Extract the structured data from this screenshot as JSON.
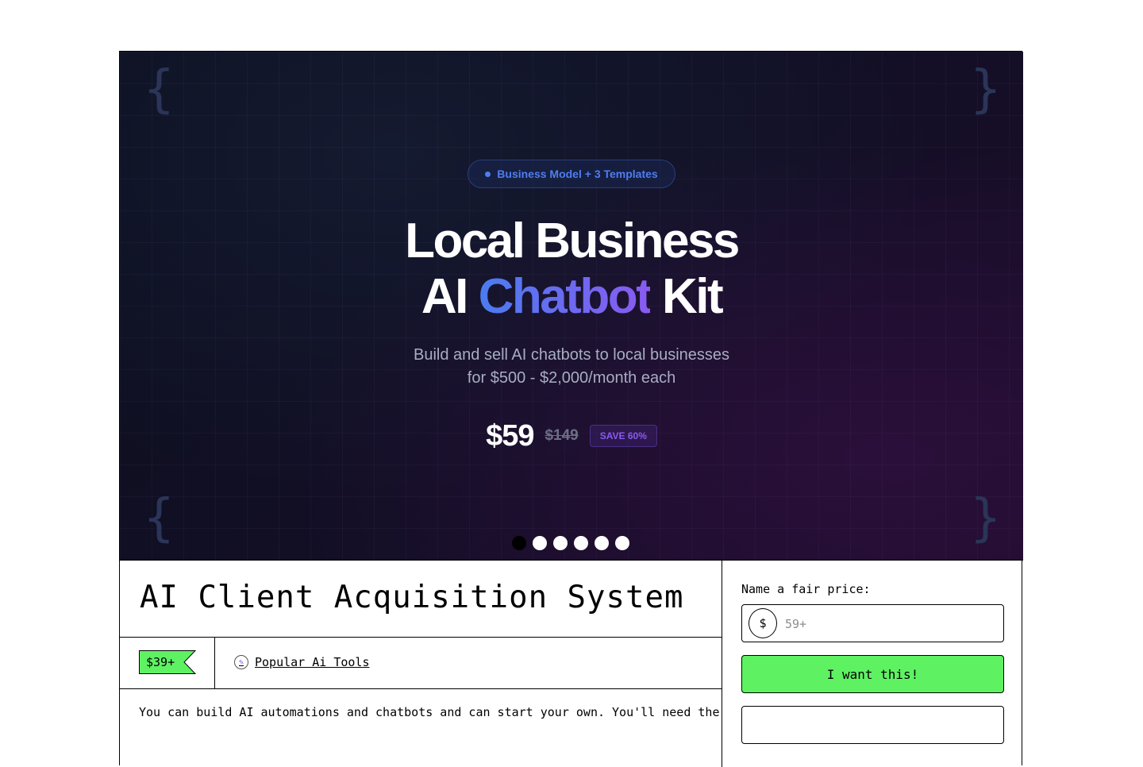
{
  "hero": {
    "badge": "Business Model + 3 Templates",
    "title_line1": "Local Business",
    "title_line2_prefix": "AI",
    "title_line2_highlight": "Chatbot",
    "title_line2_suffix": "Kit",
    "subtitle_line1": "Build and sell AI chatbots to local businesses",
    "subtitle_line2": "for $500 - $2,000/month each",
    "price": "$59",
    "original_price": "$149",
    "save_label": "SAVE 60%",
    "carousel_total": 6,
    "carousel_active": 1
  },
  "product": {
    "title": "AI Client Acquisition System",
    "price_tag": "$39+",
    "creator": "Popular Ai Tools",
    "description_partial": "You can build AI automations and chatbots and can start your own. You'll need the"
  },
  "purchase": {
    "fair_price_label": "Name a fair price:",
    "currency_symbol": "$",
    "price_placeholder": "59+",
    "price_value": "",
    "cta_label": "I want this!"
  },
  "colors": {
    "cta_green": "#5ef263",
    "accent_blue": "#4f7df0",
    "accent_purple": "#8a5af0"
  }
}
